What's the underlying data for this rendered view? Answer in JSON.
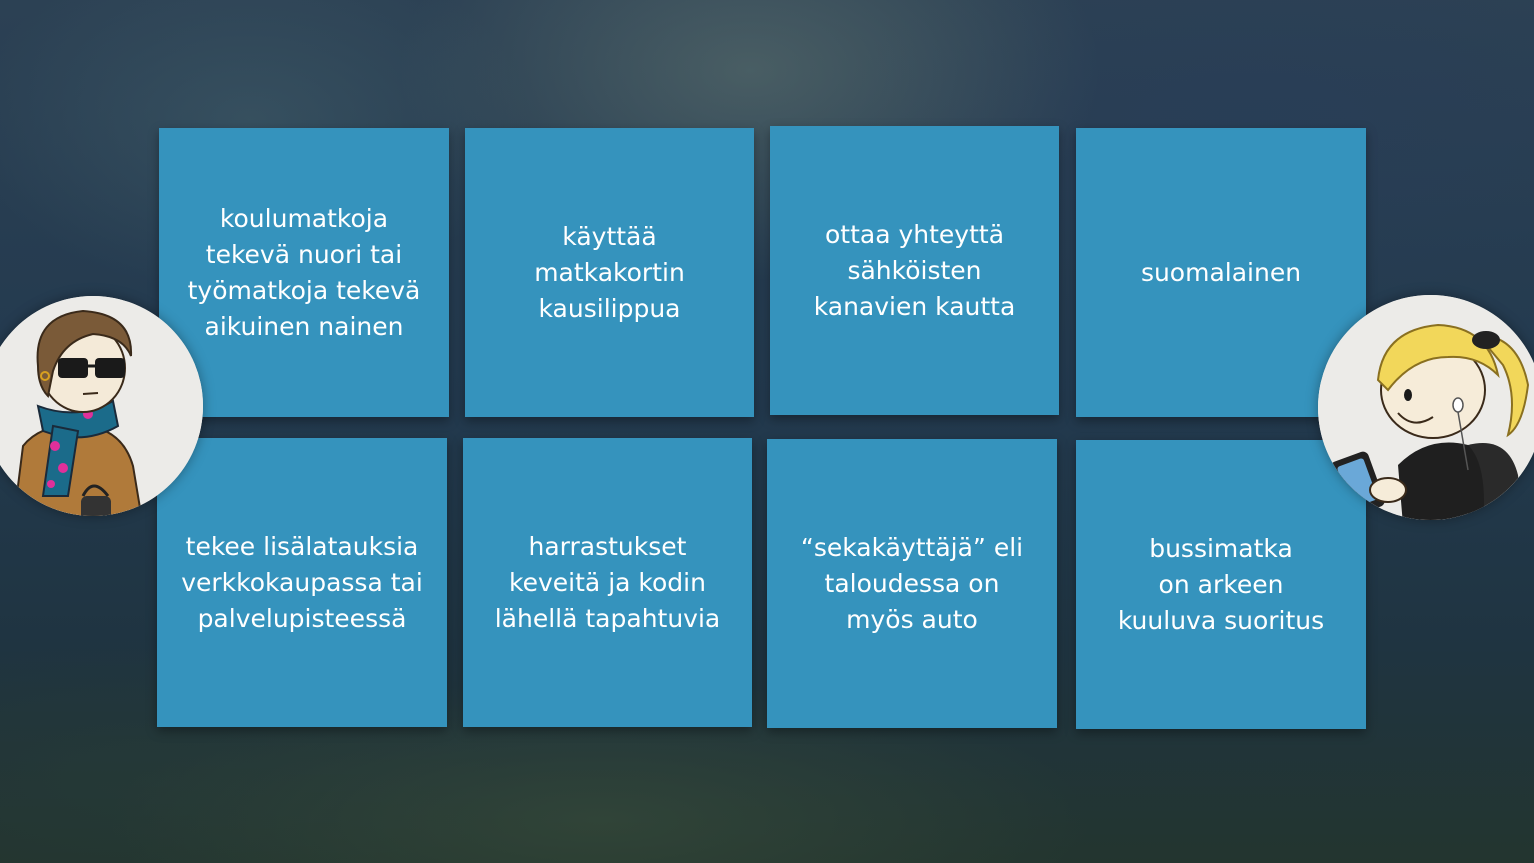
{
  "tiles": [
    {
      "text": "koulumatkoja\ntekevä nuori tai\ntyömatkoja tekevä\naikuinen nainen"
    },
    {
      "text": "käyttää\nmatkakortin\nkausilippua"
    },
    {
      "text": "ottaa yhteyttä\nsähköisten\nkanavien kautta"
    },
    {
      "text": "suomalainen"
    },
    {
      "text": "tekee lisälatauksia\nverkkokaupassa tai\npalvelupisteessä"
    },
    {
      "text": "harrastukset\nkeveitä ja kodin\nlähellä tapahtuvia"
    },
    {
      "text": "“sekakäyttäjä” eli\ntaloudessa on\nmyös auto"
    },
    {
      "text": "bussimatka\non arkeen\nkuuluva suoritus"
    }
  ],
  "colors": {
    "tile": "#3593bd",
    "tile_text": "#ffffff"
  },
  "avatars": {
    "left": "woman-with-glasses-and-scarf-illustration",
    "right": "blonde-woman-with-phone-illustration"
  }
}
